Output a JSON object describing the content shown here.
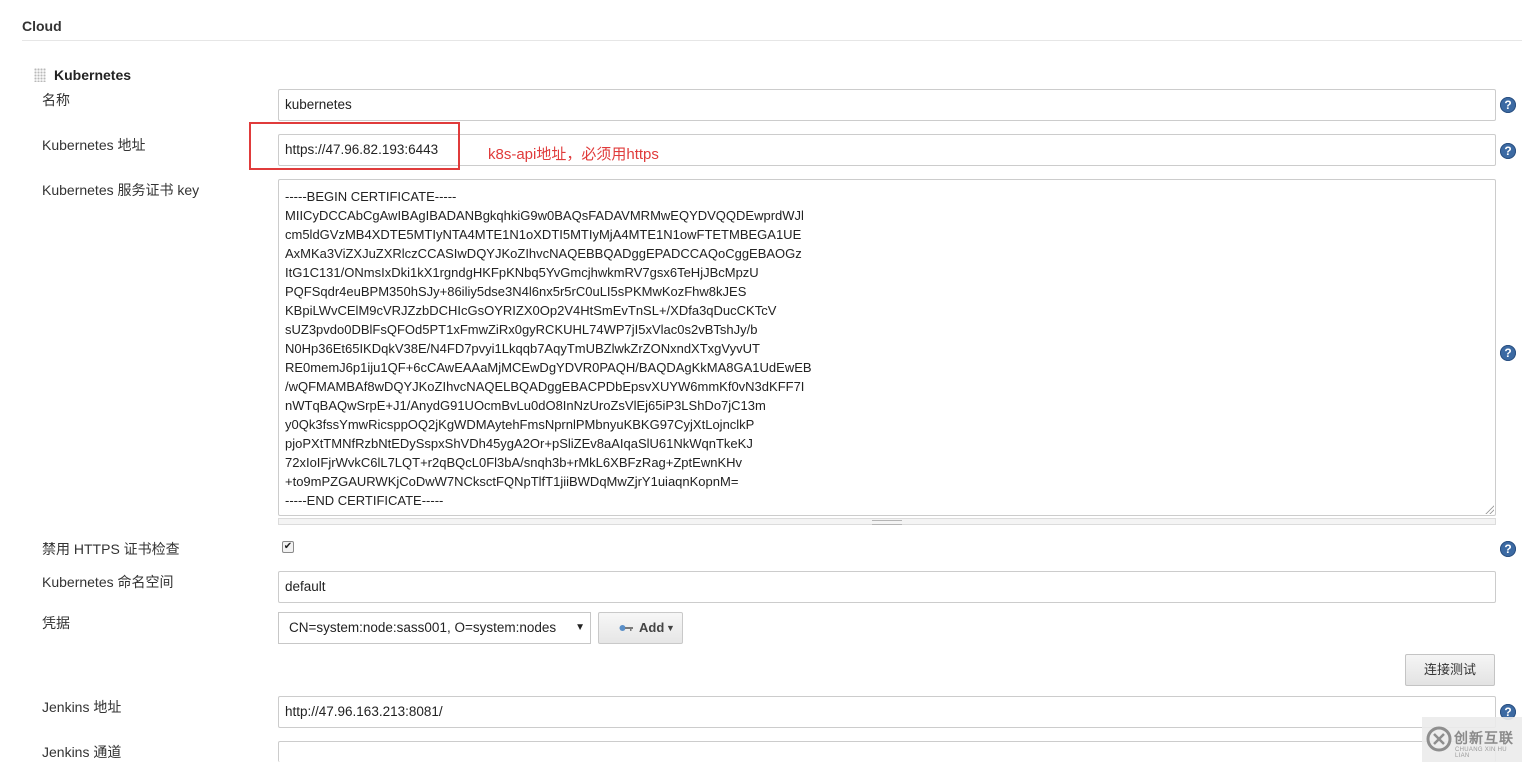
{
  "section": {
    "title": "Cloud"
  },
  "cloud": {
    "name": "Kubernetes"
  },
  "fields": {
    "name": {
      "label": "名称",
      "value": "kubernetes"
    },
    "k8s_url": {
      "label": "Kubernetes 地址",
      "value": "https://47.96.82.193:6443"
    },
    "cert_key": {
      "label": "Kubernetes 服务证书 key",
      "value": "-----BEGIN CERTIFICATE-----\nMIICyDCCAbCgAwIBAgIBADANBgkqhkiG9w0BAQsFADAVMRMwEQYDVQQDEwprdWJl\ncm5ldGVzMB4XDTE5MTIyNTA4MTE1N1oXDTI5MTIyMjA4MTE1N1owFTETMBEGA1UE\nAxMKa3ViZXJuZXRlczCCASIwDQYJKoZIhvcNAQEBBQADggEPADCCAQoCggEBAOGz\nItG1C131/ONmsIxDki1kX1rgndgHKFpKNbq5YvGmcjhwkmRV7gsx6TeHjJBcMpzU\nPQFSqdr4euBPM350hSJy+86iliy5dse3N4l6nx5r5rC0uLI5sPKMwKozFhw8kJES\nKBpiLWvCElM9cVRJZzbDCHIcGsOYRIZX0Op2V4HtSmEvTnSL+/XDfa3qDucCKTcV\nsUZ3pvdo0DBlFsQFOd5PT1xFmwZiRx0gyRCKUHL74WP7jI5xVlac0s2vBTshJy/b\nN0Hp36Et65IKDqkV38E/N4FD7pvyi1Lkqqb7AqyTmUBZlwkZrZONxndXTxgVyvUT\nRE0memJ6p1iju1QF+6cCAwEAAaMjMCEwDgYDVR0PAQH/BAQDAgKkMA8GA1UdEwEB\n/wQFMAMBAf8wDQYJKoZIhvcNAQELBQADggEBACPDbEpsvXUYW6mmKf0vN3dKFF7I\nnWTqBAQwSrpE+J1/AnydG91UOcmBvLu0dO8InNzUroZsVlEj65iP3LShDo7jC13m\ny0Qk3fssYmwRicsppOQ2jKgWDMAytehFmsNprnlPMbnyuKBKG97CyjXtLojnclkP\npjoPXtTMNfRzbNtEDySspxShVDh45ygA2Or+pSliZEv8aAIqaSlU61NkWqnTkeKJ\n72xIoIFjrWvkC6lL7LQT+r2qBQcL0Fl3bA/snqh3b+rMkL6XBFzRag+ZptEwnKHv\n+to9mPZGAURWKjCoDwW7NCksctFQNpTlfT1jiiBWDqMwZjrY1uiaqnKopnM=\n-----END CERTIFICATE-----"
    },
    "disable_https": {
      "label": "禁用 HTTPS 证书检查",
      "checked": true,
      "mark": "✔"
    },
    "namespace": {
      "label": "Kubernetes 命名空间",
      "value": "default"
    },
    "credentials": {
      "label": "凭据",
      "selected": "CN=system:node:sass001, O=system:nodes",
      "add_label": "Add"
    },
    "jenkins_url": {
      "label": "Jenkins 地址",
      "value": "http://47.96.163.213:8081/"
    },
    "jenkins_tunnel": {
      "label": "Jenkins 通道",
      "value": ""
    }
  },
  "annotation": {
    "text": "k8s-api地址，必须用https",
    "color": "#e03b3b"
  },
  "buttons": {
    "test_connection": "连接测试"
  },
  "help": {
    "glyph": "?"
  },
  "watermark": {
    "cn": "创新互联",
    "en": "CHUANG XIN HU LIAN"
  },
  "colors": {
    "help_icon": "#3c6aa3",
    "annotation": "#e03b3b",
    "border": "#cccccc"
  }
}
